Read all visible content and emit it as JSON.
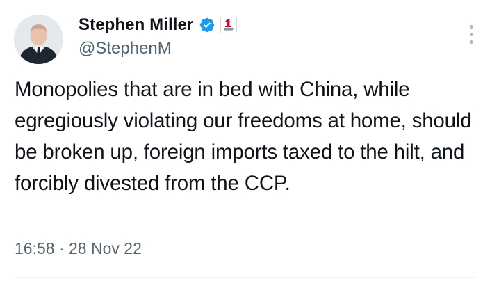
{
  "tweet": {
    "display_name": "Stephen Miller",
    "handle": "@StephenM",
    "text": "Monopolies that are in bed with China, while egregiously violating our freedoms at home, should be broken up, foreign imports taxed to the hilt, and forcibly divested from the CCP.",
    "time": "16:58",
    "separator": "·",
    "date": "28 Nov 22"
  },
  "icons": {
    "verified": "verified-badge-icon",
    "affiliate": "affiliate-badge-icon",
    "more": "more-options-icon"
  },
  "colors": {
    "verified_blue": "#1d9bf0",
    "text_primary": "#0f1419",
    "text_secondary": "#536471"
  }
}
